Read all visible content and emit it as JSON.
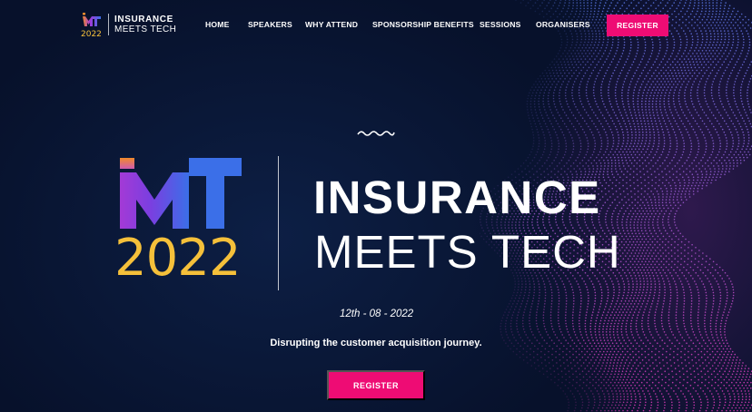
{
  "header": {
    "logo": {
      "mark_text": "iMT",
      "year": "2022",
      "line1": "INSURANCE",
      "line2": "MEETS TECH"
    },
    "nav": [
      {
        "label": "HOME",
        "name": "nav-home"
      },
      {
        "label": "SPEAKERS",
        "name": "nav-speakers"
      },
      {
        "label": "WHY ATTEND",
        "name": "nav-why-attend"
      },
      {
        "label": "SPONSORSHIP BENEFITS",
        "name": "nav-sponsorship-benefits"
      },
      {
        "label": "SESSIONS",
        "name": "nav-sessions"
      },
      {
        "label": "ORGANISERS",
        "name": "nav-organisers"
      }
    ],
    "register_label": "REGISTER"
  },
  "hero": {
    "logo": {
      "mark_text": "iMT",
      "year": "2022"
    },
    "title_line1": "INSURANCE",
    "title_line2": "MEETS TECH",
    "date": "12th - 08 - 2022",
    "tagline": "Disrupting the customer acquisition journey.",
    "register_label": "REGISTER",
    "squiggle_icon": "wave-icon"
  },
  "colors": {
    "background": "#07112b",
    "accent": "#ee0c74",
    "year_gold": "#f5c03a",
    "logo_purple": "#7a3fe0",
    "logo_blue": "#3b6fe8",
    "logo_orange": "#f08a2b"
  }
}
